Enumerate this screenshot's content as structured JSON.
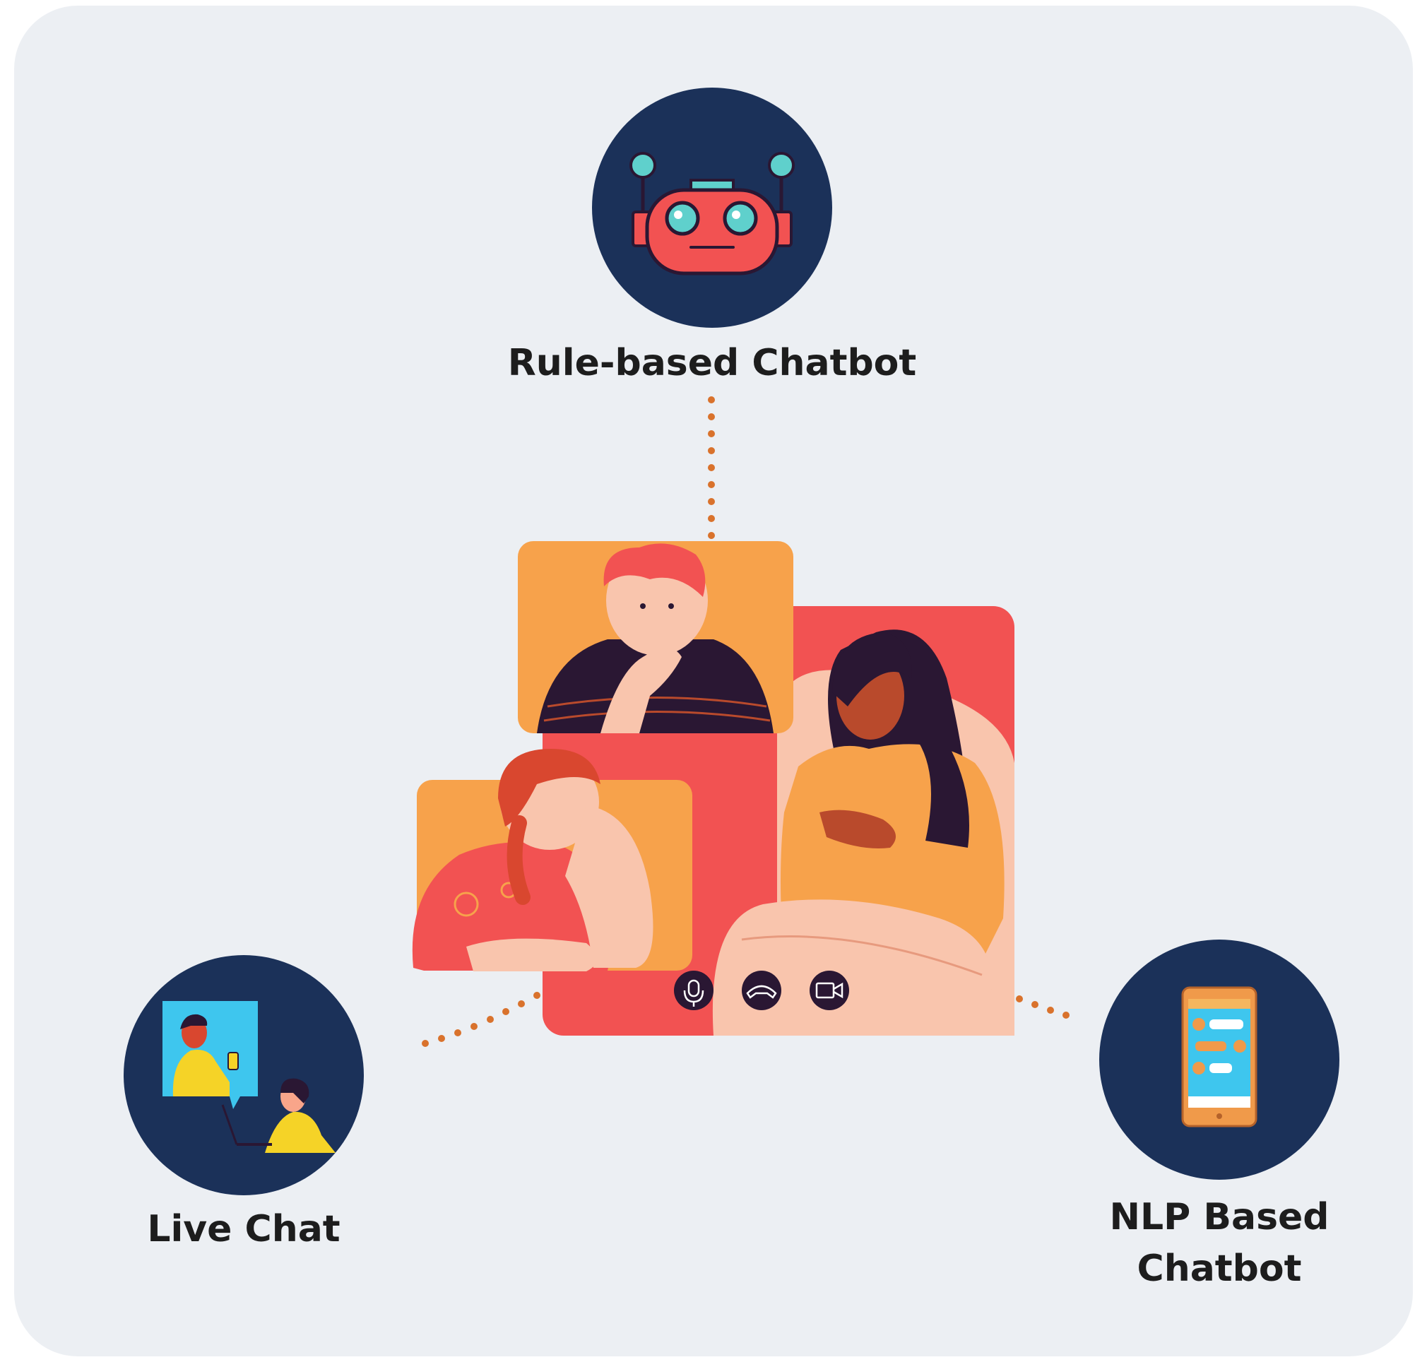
{
  "nodes": {
    "rule_based": {
      "label": "Rule-based Chatbot",
      "icon": "robot-icon"
    },
    "live_chat": {
      "label": "Live Chat",
      "icon": "live-chat-people-icon"
    },
    "nlp_based": {
      "label_line1": "NLP Based",
      "label_line2": "Chatbot",
      "icon": "smartphone-chat-icon"
    }
  },
  "center": {
    "illustration": "video-call-illustration"
  },
  "colors": {
    "background": "#eceff3",
    "node_fill": "#1b3159",
    "connector": "#d9722c",
    "call_panel": "#f25252",
    "tile_orange": "#f7a24b"
  }
}
